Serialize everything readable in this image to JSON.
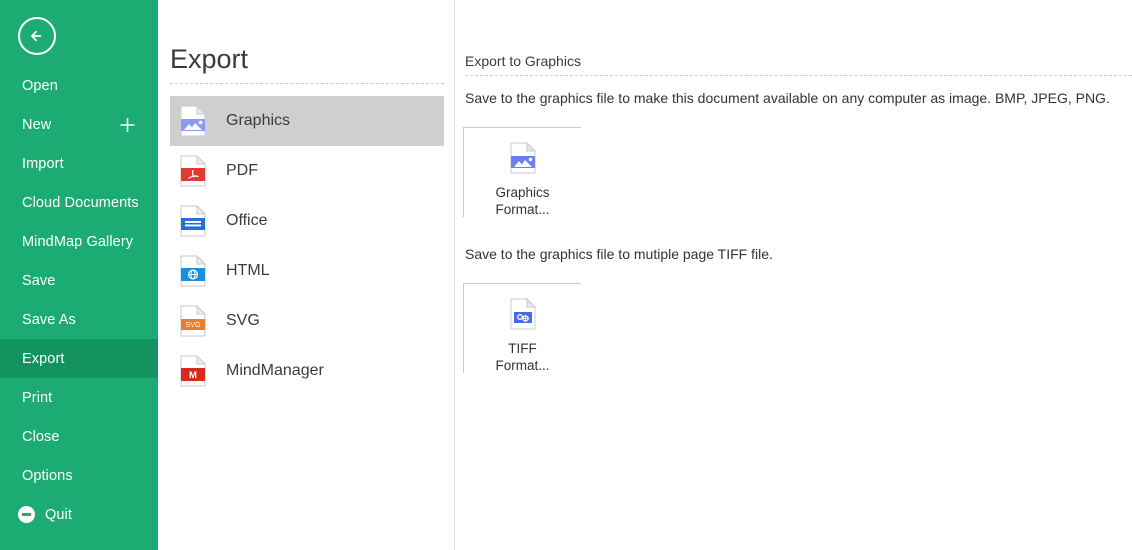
{
  "sidebar": {
    "back_label": "Back",
    "items": [
      {
        "label": "Open",
        "icon": "",
        "active": false
      },
      {
        "label": "New",
        "icon": "plus-icon",
        "active": false
      },
      {
        "label": "Import",
        "icon": "",
        "active": false
      },
      {
        "label": "Cloud Documents",
        "icon": "",
        "active": false
      },
      {
        "label": "MindMap Gallery",
        "icon": "",
        "active": false
      },
      {
        "label": "Save",
        "icon": "",
        "active": false
      },
      {
        "label": "Save As",
        "icon": "",
        "active": false
      },
      {
        "label": "Export",
        "icon": "",
        "active": true
      },
      {
        "label": "Print",
        "icon": "",
        "active": false
      },
      {
        "label": "Close",
        "icon": "",
        "active": false
      },
      {
        "label": "Options",
        "icon": "",
        "active": false
      },
      {
        "label": "Quit",
        "icon": "quit-icon",
        "active": false
      }
    ],
    "bg_color": "#1DAB74",
    "active_color": "#13935F"
  },
  "middle": {
    "title": "Export",
    "items": [
      {
        "label": "Graphics",
        "icon": "graphics-file-icon",
        "active": true
      },
      {
        "label": "PDF",
        "icon": "pdf-file-icon",
        "active": false
      },
      {
        "label": "Office",
        "icon": "office-file-icon",
        "active": false
      },
      {
        "label": "HTML",
        "icon": "html-file-icon",
        "active": false
      },
      {
        "label": "SVG",
        "icon": "svg-file-icon",
        "active": false
      },
      {
        "label": "MindManager",
        "icon": "mindmanager-file-icon",
        "active": false
      }
    ],
    "selected_color": "#cfcfcf"
  },
  "right": {
    "title": "Export to Graphics",
    "description_1": "Save to the graphics file to make this document available on any computer as image.  BMP, JPEG, PNG.",
    "description_2": "Save to the graphics file to mutiple page TIFF file.",
    "buttons": [
      {
        "line1": "Graphics",
        "line2": "Format...",
        "icon": "graphics-file-icon"
      },
      {
        "line1": "TIFF",
        "line2": "Format...",
        "icon": "tiff-file-icon"
      }
    ]
  }
}
